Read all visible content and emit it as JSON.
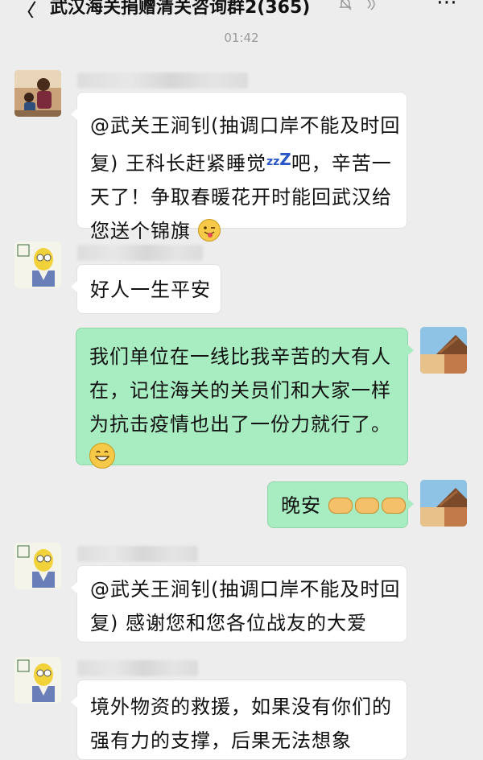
{
  "header": {
    "back_glyph": "〈",
    "title": "武汉海关捐赠清关咨询群2(365)",
    "more_glyph": "⋯"
  },
  "timestamp": "01:42",
  "messages": [
    {
      "id": "m1",
      "direction": "in",
      "lines": [
        "@武关王涧钊(抽调口岸不能及时回",
        "复) 王科长赶紧睡觉",
        "天了！争取春暖花开时能回武汉给",
        "您送个锦旗"
      ],
      "inline_parts": {
        "before_zzz": "复) 王科长赶紧睡觉",
        "zzz": "zz",
        "zzz_big": "Z",
        "after_zzz": "吧，辛苦一"
      },
      "emoji": "tongue-wink-emoji"
    },
    {
      "id": "m2",
      "direction": "in",
      "lines": [
        "好人一生平安"
      ]
    },
    {
      "id": "m3",
      "direction": "out",
      "lines": [
        "我们单位在一线比我辛苦的大有人",
        "在，记住海关的关员们和大家一样",
        "为抗击疫情也出了一份力就行了。"
      ],
      "emoji": "grin-emoji"
    },
    {
      "id": "m4",
      "direction": "out",
      "lines": [
        "晚安"
      ],
      "emoji": "handshake-emoji"
    },
    {
      "id": "m5",
      "direction": "in",
      "lines": [
        "@武关王涧钊(抽调口岸不能及时回",
        "复) 感谢您和您各位战友的大爱"
      ]
    },
    {
      "id": "m6",
      "direction": "in",
      "lines": [
        "境外物资的救援，如果没有你们的",
        "强有力的支撑，后果无法想象"
      ]
    }
  ],
  "colors": {
    "background": "#ededed",
    "incoming_bubble": "#ffffff",
    "outgoing_bubble": "#a8ecc1",
    "timestamp": "#9a9a9a"
  }
}
